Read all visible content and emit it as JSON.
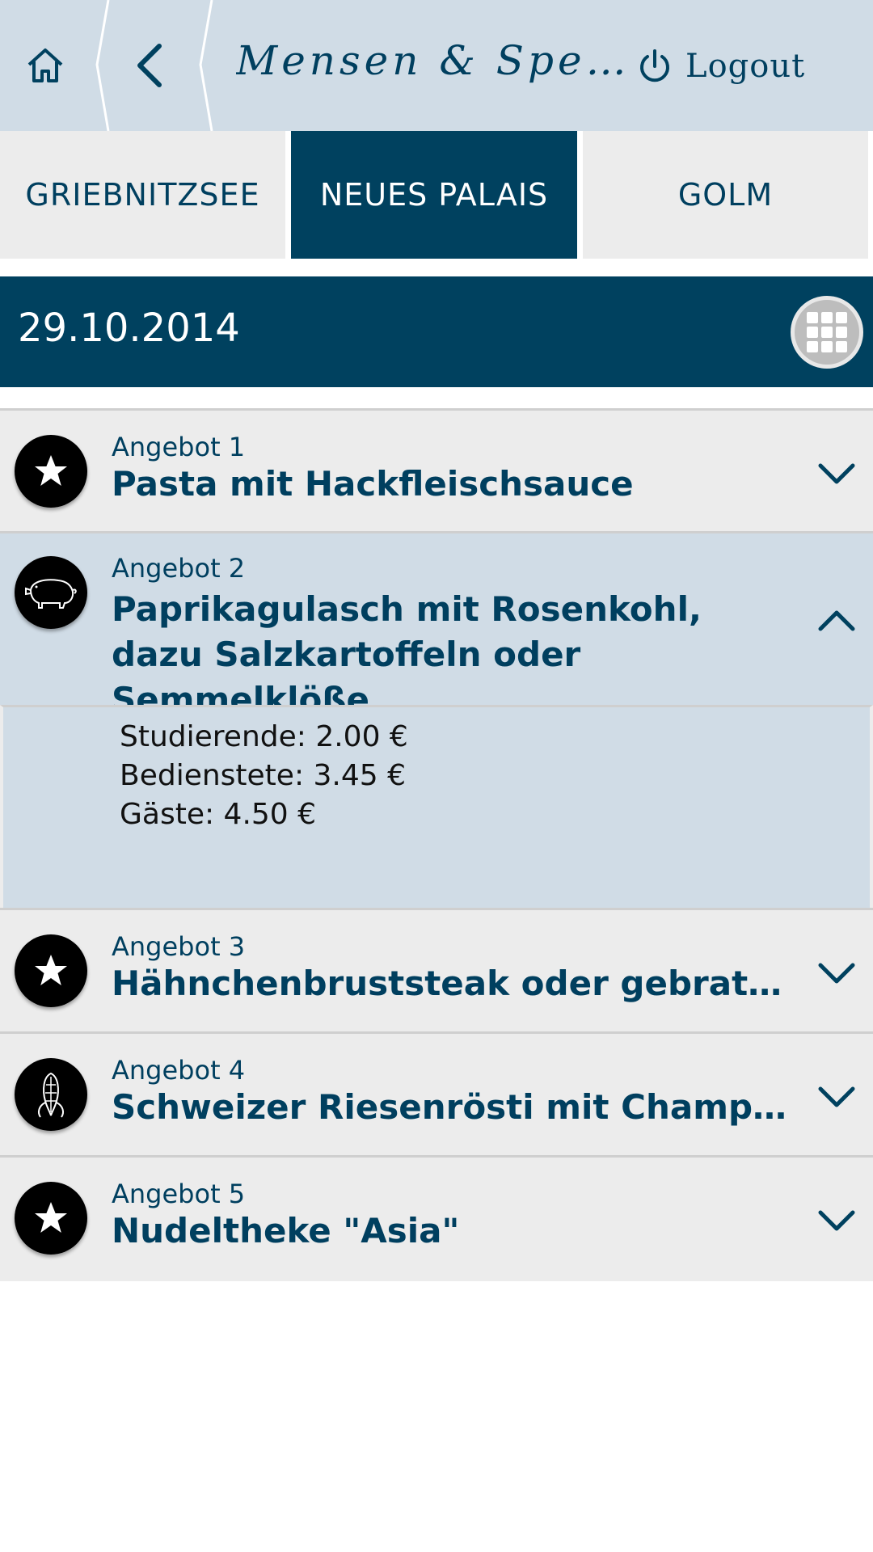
{
  "header": {
    "title": "Mensen & Speise...",
    "logout_label": "Logout"
  },
  "tabs": [
    {
      "label": "GRIEBNITZSEE",
      "active": false
    },
    {
      "label": "NEUES PALAIS",
      "active": true
    },
    {
      "label": "GOLM",
      "active": false
    }
  ],
  "date": "29.10.2014",
  "offers": [
    {
      "category": "Angebot 1",
      "name": "Pasta mit Hackfleischsauce",
      "icon": "star-icon",
      "expanded": false
    },
    {
      "category": "Angebot 2",
      "name": "Paprikagulasch mit Rosenkohl, dazu Salzkartoffeln oder Semmelklöße",
      "icon": "pig-icon",
      "expanded": true,
      "prices": [
        "Studierende: 2.00 €",
        "Bedienstete: 3.45 €",
        "Gäste: 4.50 €"
      ]
    },
    {
      "category": "Angebot 3",
      "name": "Hähnchenbruststeak oder gebratenes Se...",
      "icon": "star-icon",
      "expanded": false
    },
    {
      "category": "Angebot 4",
      "name": "Schweizer Riesenrösti mit Champignons,...",
      "icon": "corn-icon",
      "expanded": false
    },
    {
      "category": "Angebot 5",
      "name": "Nudeltheke \"Asia\"",
      "icon": "star-icon",
      "expanded": false
    }
  ],
  "colors": {
    "primary": "#00415f",
    "header_bg": "#d0dce6",
    "item_bg": "#ececec",
    "expanded_bg": "#d0dce6"
  }
}
